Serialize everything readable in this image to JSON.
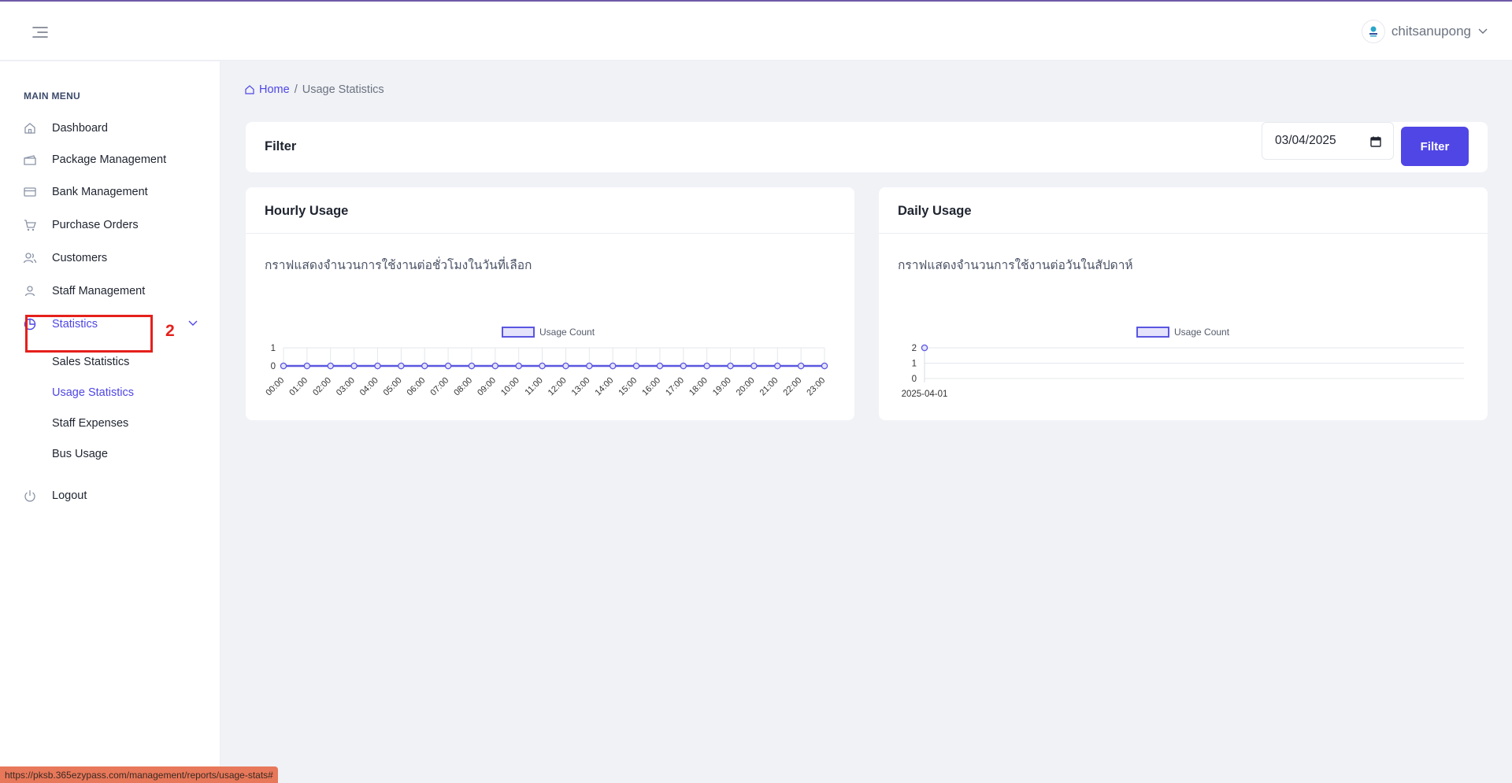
{
  "header": {
    "user_name": "chitsanupong"
  },
  "sidebar": {
    "menu_title": "MAIN MENU",
    "items": [
      {
        "label": "Dashboard"
      },
      {
        "label": "Package Management"
      },
      {
        "label": "Bank Management"
      },
      {
        "label": "Purchase Orders"
      },
      {
        "label": "Customers"
      },
      {
        "label": "Staff Management"
      },
      {
        "label": "Statistics"
      }
    ],
    "statistics_sub": [
      {
        "label": "Sales Statistics"
      },
      {
        "label": "Usage Statistics"
      },
      {
        "label": "Staff Expenses"
      },
      {
        "label": "Bus Usage"
      }
    ],
    "logout": "Logout"
  },
  "annotation": {
    "number": "2",
    "color": "#e5201b"
  },
  "breadcrumb": {
    "home": "Home",
    "separator": "/",
    "current": "Usage Statistics"
  },
  "filter": {
    "title": "Filter",
    "date_value": "03/04/2025",
    "button_label": "Filter"
  },
  "hourly": {
    "title": "Hourly Usage",
    "description": "กราฟแสดงจำนวนการใช้งานต่อชั่วโมงในวันที่เลือก"
  },
  "daily": {
    "title": "Daily Usage",
    "description": "กราฟแสดงจำนวนการใช้งานต่อวันในสัปดาห์"
  },
  "chart_data": [
    {
      "type": "line",
      "legend": "Usage Count",
      "legend_position": "top",
      "categories": [
        "00:00",
        "01:00",
        "02:00",
        "03:00",
        "04:00",
        "05:00",
        "06:00",
        "07:00",
        "08:00",
        "09:00",
        "10:00",
        "11:00",
        "12:00",
        "13:00",
        "14:00",
        "15:00",
        "16:00",
        "17:00",
        "18:00",
        "19:00",
        "20:00",
        "21:00",
        "22:00",
        "23:00"
      ],
      "series": [
        {
          "name": "Usage Count",
          "values": [
            0,
            0,
            0,
            0,
            0,
            0,
            0,
            0,
            0,
            0,
            0,
            0,
            0,
            0,
            0,
            0,
            0,
            0,
            0,
            0,
            0,
            0,
            0,
            0
          ]
        }
      ],
      "ylim": [
        0,
        1
      ],
      "yticks": [
        0,
        1
      ],
      "grid": true,
      "color": "#5b56e0"
    },
    {
      "type": "line",
      "legend": "Usage Count",
      "legend_position": "top",
      "categories": [
        "2025-04-01"
      ],
      "series": [
        {
          "name": "Usage Count",
          "values": [
            2
          ]
        }
      ],
      "ylim": [
        0,
        2
      ],
      "yticks": [
        0,
        1,
        2
      ],
      "grid": true,
      "color": "#5b56e0"
    }
  ],
  "status_bar": {
    "url": "https://pksb.365ezypass.com/management/reports/usage-stats#"
  }
}
